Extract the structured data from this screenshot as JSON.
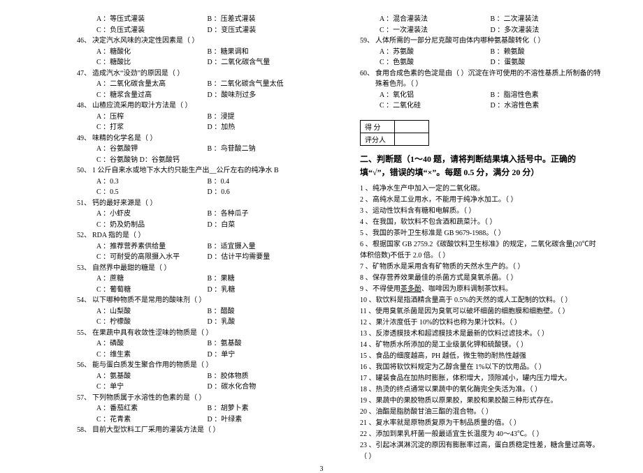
{
  "left": {
    "preOpts": [
      {
        "a": "A ：等压式灌装",
        "b": "B ：压差式灌装"
      },
      {
        "a": "C ：负压式灌装",
        "b": "D ：变压式灌装"
      }
    ],
    "questions": [
      {
        "num": "46、",
        "text": "决定汽水风味的决定性因素是（    ）",
        "opts": [
          {
            "a": "A ：糖酸化",
            "b": "B ：糖果调和"
          },
          {
            "a": "C ：糖酸比",
            "b": "D ：二氧化碳含气量"
          }
        ]
      },
      {
        "num": "47、",
        "text": "造成汽水“没劲”的原因是（    ）",
        "opts": [
          {
            "a": "A ：二氧化碳含量太高",
            "b": "B ：二氧化碳含气量太低"
          },
          {
            "a": "C ：糖浆含量过高",
            "b": "D ：酸味剂过多"
          }
        ]
      },
      {
        "num": "48、",
        "text": "山楂应流采用的取汁方法是（    ）",
        "opts": [
          {
            "a": "A ：压榨",
            "b": "B ：浸提"
          },
          {
            "a": "C ：打浆",
            "b": "D ：加热"
          }
        ]
      },
      {
        "num": "49、",
        "text": "味精的化学名是（    ）",
        "opts": [
          {
            "a": "A ：谷氨酸钾",
            "b": "B ：鸟苷酸二钠"
          },
          {
            "a": "C ：谷氨酸钠 D：谷氨酸钙",
            "b": ""
          }
        ]
      },
      {
        "num": "50、",
        "text": "1 公斤自来水或地下水大约只能生产出__公斤左右的纯净水 B",
        "opts": [
          {
            "a": "A ：0.3",
            "b": "B ：0.4"
          },
          {
            "a": "C ：0.5",
            "b": "D ：0.6"
          }
        ]
      },
      {
        "num": "51、",
        "text": "钙的最好来源是（    ）",
        "opts": [
          {
            "a": "A ：小虾皮",
            "b": "B ：各种瓜子"
          },
          {
            "a": "C ：奶及奶制品",
            "b": "D ：白菜"
          }
        ]
      },
      {
        "num": "52、",
        "text": "RDA 指的是（    ）",
        "opts": [
          {
            "a": "A ：推荐营养素供给量",
            "b": "B ：适宜摄入量"
          },
          {
            "a": "C ：可耐受的高限摄入水平",
            "b": "D ：估计平均需要量"
          }
        ]
      },
      {
        "num": "53、",
        "text": "自然界中最甜的糖是（    ）",
        "opts": [
          {
            "a": "A ：蔗糖",
            "b": "B ：果糖"
          },
          {
            "a": "C ：葡萄糖",
            "b": "D ：乳糖"
          }
        ]
      },
      {
        "num": "54、",
        "text": "以下哪种物质不是常用的酸味剂（    ）",
        "opts": [
          {
            "a": "A ：山梨酸",
            "b": "B ：醋酸"
          },
          {
            "a": "C ：柠檬酸",
            "b": "D ：乳酸"
          }
        ]
      },
      {
        "num": "55、",
        "text": "在果蔬中具有收敛性涩味的物质是（    ）",
        "opts": [
          {
            "a": "A ：磷酸",
            "b": "B ：氨基酸"
          },
          {
            "a": "C ：维生素",
            "b": "D ：单宁"
          }
        ]
      },
      {
        "num": "56、",
        "text": "能与蛋白质发生聚合作用的物质是（    ）",
        "opts": [
          {
            "a": "A ：氨基酸",
            "b": "B ：胶体物质"
          },
          {
            "a": "C ：单宁",
            "b": "D ：碳水化合物"
          }
        ]
      },
      {
        "num": "57、",
        "text": "下列物质属于水溶性的色素的是（    ）",
        "opts": [
          {
            "a": "A ：番茄红素",
            "b": "B ：胡萝卜素"
          },
          {
            "a": "C ：花青素",
            "b": "D ：叶绿素"
          }
        ]
      },
      {
        "num": "58、",
        "text": "目前大型饮料工厂采用的灌装方法是（    ）",
        "opts": []
      }
    ]
  },
  "right": {
    "preOpts": [
      {
        "a": "A ：混合灌装法",
        "b": "B ：二次灌装法"
      },
      {
        "a": "C ：一次灌装法",
        "b": "D ：多次灌装法"
      }
    ],
    "questions": [
      {
        "num": "59、",
        "text": "人体所需的一部分尼克酸可由体内哪种氨基酸转化（    ）",
        "opts": [
          {
            "a": "A ：苏氨酸",
            "b": "B ：赖氨酸"
          },
          {
            "a": "C ：色氨酸",
            "b": "D ：蛋氨酸"
          }
        ]
      },
      {
        "num": "60、",
        "text": "食用合成色素的色淀是由（    ）沉淀在许可使用的不溶性基质上所制备的特殊着色剂。（    ）",
        "opts": [
          {
            "a": "A ：氧化铝",
            "b": "B ：脂溶性色素"
          },
          {
            "a": "C ：二氧化硅",
            "b": "D ：水溶性色素"
          }
        ]
      }
    ],
    "scoreTable": {
      "row1": "得  分",
      "row2": "评分人"
    },
    "section": {
      "title": "二、判断题（1～40 题，请将判断结果填入括号中。正确的填“√”，错误的填“×”。每题 0.5 分，满分 20 分）",
      "items": [
        {
          "n": "1 、",
          "t": "纯净水生产中加入一定的二氧化碳。"
        },
        {
          "n": "2 、",
          "t": "高纯水是工业用水，不能用于纯净水加工。（    ）"
        },
        {
          "n": "3 、",
          "t": "运动性饮料含有糖和电解质。（    ）"
        },
        {
          "n": "4 、",
          "t": "在我国，软饮料不包含酒和蔬菜汁。（    ）"
        },
        {
          "n": "5 、",
          "t": "我国的茶叶卫生标准是 GB 9679-1988。（    ）"
        },
        {
          "n": "6 、",
          "t": "根据国家 GB 2759.2《碳酸饮料卫生标准》的规定，二氧化碳含量(20℃时体积倍数)不低于 2.0 倍。（    ）"
        },
        {
          "n": "7 、",
          "t": "矿物质水是采用含有矿物质的天然水生产的。（    ）"
        },
        {
          "n": "8 、",
          "t": "保存营养效果最佳的杀菌方式是臭氧杀菌。（    ）"
        },
        {
          "n": "9 、",
          "t": "不得使用",
          "u": "茶多酚",
          "t2": "、咖啡因为原料调制茶饮料。"
        },
        {
          "n": "10 、",
          "t": "软饮料是指酒精含量高于 0.5%的天然的或人工配制的饮料。（    ）"
        },
        {
          "n": "11 、",
          "t": "使用臭氧杀菌是因为臭氧可以破坏细菌的细胞膜和细胞壁。（    ）"
        },
        {
          "n": "12 、",
          "t": "果汁浓度低于 10%的饮料也称为果汁饮料。（    ）"
        },
        {
          "n": "13 、",
          "t": "反渗透膜技术和超滤膜技术是最新的饮料过滤技术。（    ）"
        },
        {
          "n": "14 、",
          "t": "矿物质水所添加的是工业级氯化钾和硫酸镁。（    ）"
        },
        {
          "n": "15 、",
          "t": "食品的细度越高，PH 越低，微生物的耐热性越强"
        },
        {
          "n": "16 、",
          "t": "我国将软饮料规定为乙醇含量在 1%以下的饮用品。（    ）"
        },
        {
          "n": "17 、",
          "t": "罐装食品在加热时膨胀，体积增大，顶隙减小，罐内压力增大。"
        },
        {
          "n": "18 、",
          "t": "热烫的终点通常以果蔬中的氧化酶完全失活为准。（    ）"
        },
        {
          "n": "19 、",
          "t": "果蔬中的果胶物质以原果胶，果胶和果胶酸三种形式存在。"
        },
        {
          "n": "20 、",
          "t": "油酯是脂肪酸甘油三酯的混合物。（    ）"
        },
        {
          "n": "21 、",
          "t": "复水率就是原物质复原为干制品质量的值。（    ）"
        },
        {
          "n": "22 、",
          "t": "添加到果乳杆菌一般最适宜生长温度为 40～43℃。（    ）"
        },
        {
          "n": "23 、",
          "t": "引起冰淇淋沉淀的原因有膨胀率过高，蛋白质稳定性差，糖含量过高等。（    ）"
        }
      ]
    }
  },
  "pageNum": "3"
}
